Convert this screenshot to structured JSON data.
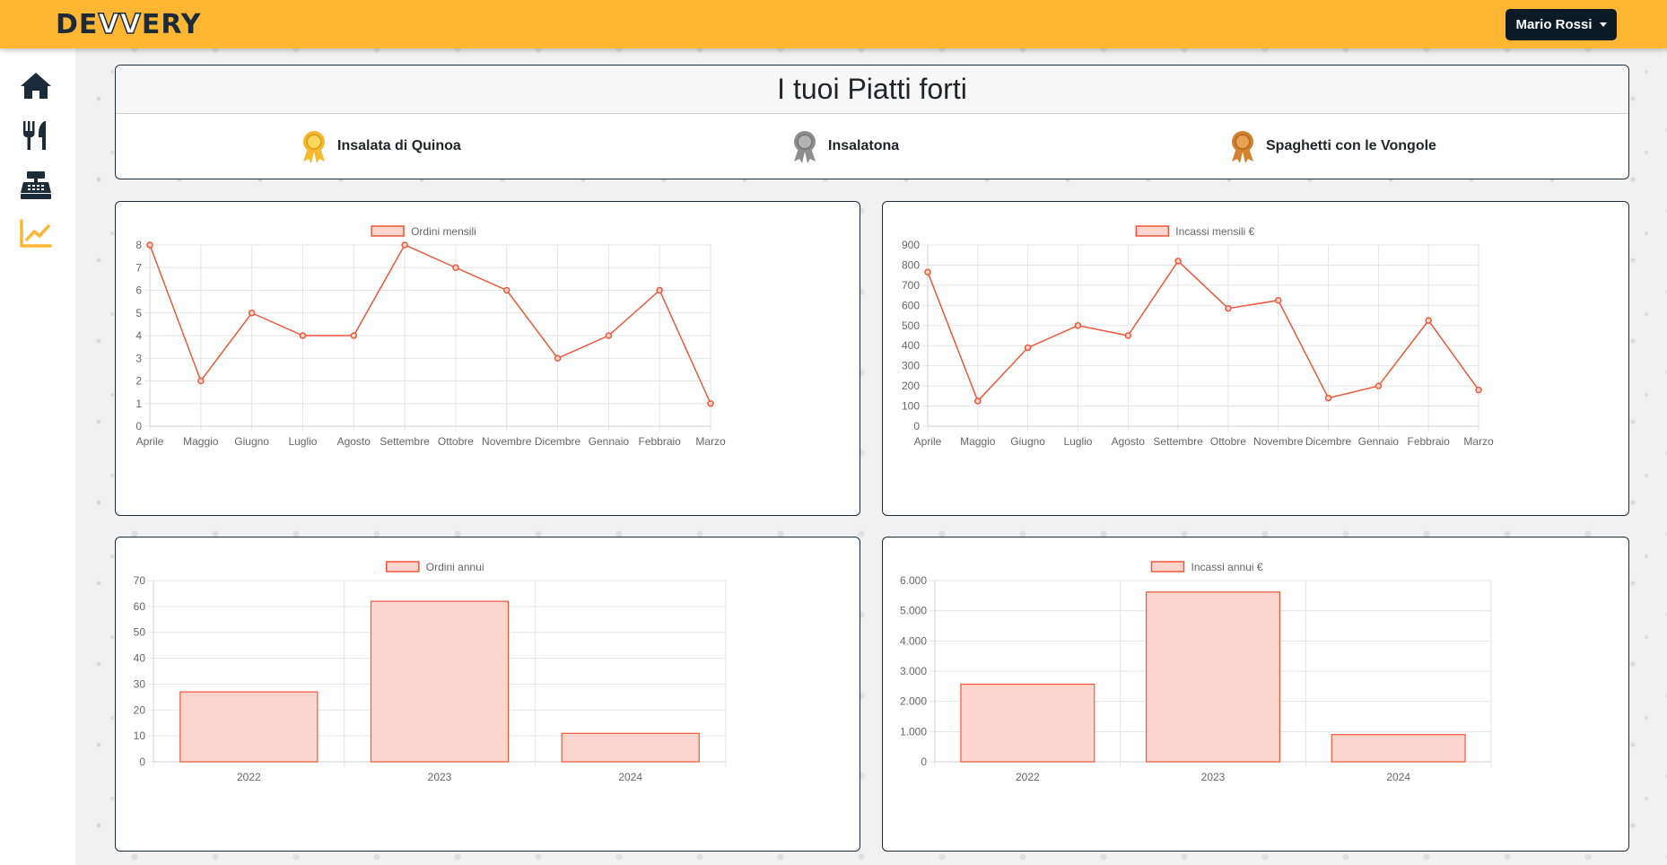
{
  "app": {
    "logo_text": "DEVVERY",
    "user_name": "Mario Rossi"
  },
  "sidebar": {
    "items": [
      {
        "icon": "home-icon",
        "active": false
      },
      {
        "icon": "utensils-icon",
        "active": false
      },
      {
        "icon": "cash-register-icon",
        "active": false
      },
      {
        "icon": "chart-line-icon",
        "active": true
      }
    ],
    "active_color": "#ffb733",
    "icon_color": "#1c2b39"
  },
  "top_dishes": {
    "title": "I tuoi Piatti forti",
    "items": [
      {
        "name": "Insalata di Quinoa",
        "medal": "gold-medal-icon",
        "color": "#f5b82e"
      },
      {
        "name": "Insalatona",
        "medal": "silver-medal-icon",
        "color": "#8e8e8e"
      },
      {
        "name": "Spaghetti con le Vongole",
        "medal": "bronze-medal-icon",
        "color": "#d4822e"
      }
    ]
  },
  "colors": {
    "accent": "#ffb733",
    "dark": "#1c2b39",
    "line": "#f0573a",
    "bar_fill": "#fcd5cc"
  },
  "chart_data": [
    {
      "type": "line",
      "legend": "Ordini mensili",
      "categories": [
        "Aprile",
        "Maggio",
        "Giugno",
        "Luglio",
        "Agosto",
        "Settembre",
        "Ottobre",
        "Novembre",
        "Dicembre",
        "Gennaio",
        "Febbraio",
        "Marzo"
      ],
      "values": [
        8,
        2,
        5,
        4,
        4,
        8,
        7,
        6,
        3,
        4,
        6,
        1
      ],
      "ylim": [
        0,
        8
      ],
      "yticks": [
        "0",
        "1",
        "2",
        "3",
        "4",
        "5",
        "6",
        "7",
        "8"
      ],
      "grid": true,
      "legend_position": "top"
    },
    {
      "type": "line",
      "legend": "Incassi mensili €",
      "categories": [
        "Aprile",
        "Maggio",
        "Giugno",
        "Luglio",
        "Agosto",
        "Settembre",
        "Ottobre",
        "Novembre",
        "Dicembre",
        "Gennaio",
        "Febbraio",
        "Marzo"
      ],
      "values": [
        765,
        125,
        390,
        500,
        450,
        820,
        585,
        625,
        140,
        200,
        525,
        180
      ],
      "ylim": [
        0,
        900
      ],
      "yticks": [
        "0",
        "100",
        "200",
        "300",
        "400",
        "500",
        "600",
        "700",
        "800",
        "900"
      ],
      "grid": true,
      "legend_position": "top"
    },
    {
      "type": "bar",
      "legend": "Ordini annui",
      "categories": [
        "2022",
        "2023",
        "2024"
      ],
      "values": [
        27,
        62,
        11
      ],
      "ylim": [
        0,
        70
      ],
      "yticks": [
        "0",
        "10",
        "20",
        "30",
        "40",
        "50",
        "60",
        "70"
      ],
      "grid": true,
      "legend_position": "top"
    },
    {
      "type": "bar",
      "legend": "Incassi annui €",
      "categories": [
        "2022",
        "2023",
        "2024"
      ],
      "values": [
        2570,
        5620,
        900
      ],
      "ylim": [
        0,
        6000
      ],
      "yticks": [
        "0",
        "1.000",
        "2.000",
        "3.000",
        "4.000",
        "5.000",
        "6.000"
      ],
      "grid": true,
      "legend_position": "top"
    }
  ]
}
